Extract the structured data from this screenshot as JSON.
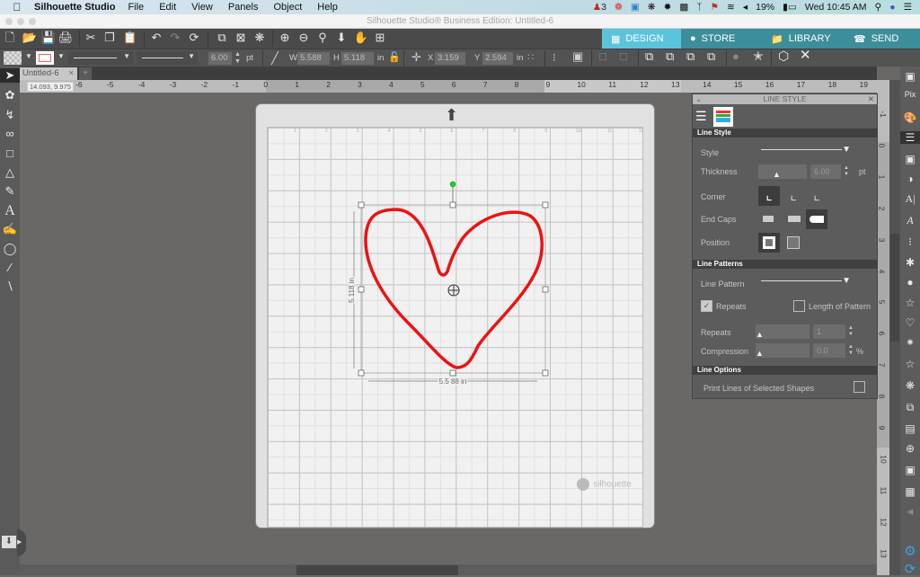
{
  "menubar": {
    "app": "Silhouette Studio",
    "items": [
      "File",
      "Edit",
      "View",
      "Panels",
      "Object",
      "Help"
    ],
    "status": {
      "notifications": "3",
      "battery": "19%",
      "clock": "Wed 10:45 AM"
    }
  },
  "window": {
    "title": "Silhouette Studio® Business Edition: Untitled-6"
  },
  "nav": {
    "design": "DESIGN",
    "store": "STORE",
    "library": "LIBRARY",
    "send": "SEND",
    "accent": "#5bc4dc",
    "bar": "#3c8e9a"
  },
  "toolbar": {
    "thickness": "6.00",
    "thickness_unit": "pt",
    "w_label": "W",
    "w": "5.588",
    "h_label": "H",
    "h": "5.118",
    "size_unit": "in",
    "x_label": "X",
    "x": "3.159",
    "y_label": "Y",
    "y": "2.594",
    "pos_unit": "in"
  },
  "tabs": [
    {
      "label": "Untitled-6",
      "close": "×"
    },
    {
      "label": "+"
    }
  ],
  "coords": {
    "x": "14.093",
    "y": "9.975"
  },
  "ruler": {
    "top": [
      "-6",
      "-5",
      "-4",
      "-3",
      "-2",
      "-1",
      "0",
      "1",
      "2",
      "3",
      "4",
      "5",
      "6",
      "7",
      "8",
      "9",
      "10",
      "11",
      "12",
      "13",
      "14",
      "15",
      "16",
      "17",
      "18",
      "19"
    ],
    "right": [
      "-1",
      "0",
      "1",
      "2",
      "3",
      "4",
      "5",
      "6",
      "7",
      "8",
      "9",
      "10",
      "11",
      "12",
      "13"
    ]
  },
  "mat": {
    "grid_labels": [
      "1",
      "2",
      "3",
      "4",
      "5",
      "6",
      "7",
      "8",
      "9",
      "10",
      "11",
      "12"
    ],
    "brand": "silhouette"
  },
  "shape": {
    "stroke_color": "#ee1111",
    "width_dim": "5.5 88 in",
    "height_dim": "5.118 in"
  },
  "panel": {
    "title": "LINE STYLE",
    "sections": {
      "line_style": "Line Style",
      "line_patterns": "Line Patterns",
      "line_options": "Line Options"
    },
    "style_label": "Style",
    "thickness_label": "Thickness",
    "thickness_value": "6.00",
    "thickness_unit": "pt",
    "corner_label": "Corner",
    "endcaps_label": "End Caps",
    "position_label": "Position",
    "pattern_label": "Line Pattern",
    "repeats_check": "Repeats",
    "length_check": "Length of Pattern",
    "repeats_label": "Repeats",
    "repeats_value": "1",
    "compression_label": "Compression",
    "compression_value": "0.0",
    "compression_unit": "%",
    "print_lines": "Print Lines of Selected Shapes",
    "repeats_checked": true,
    "length_checked": false,
    "print_checked": false
  }
}
